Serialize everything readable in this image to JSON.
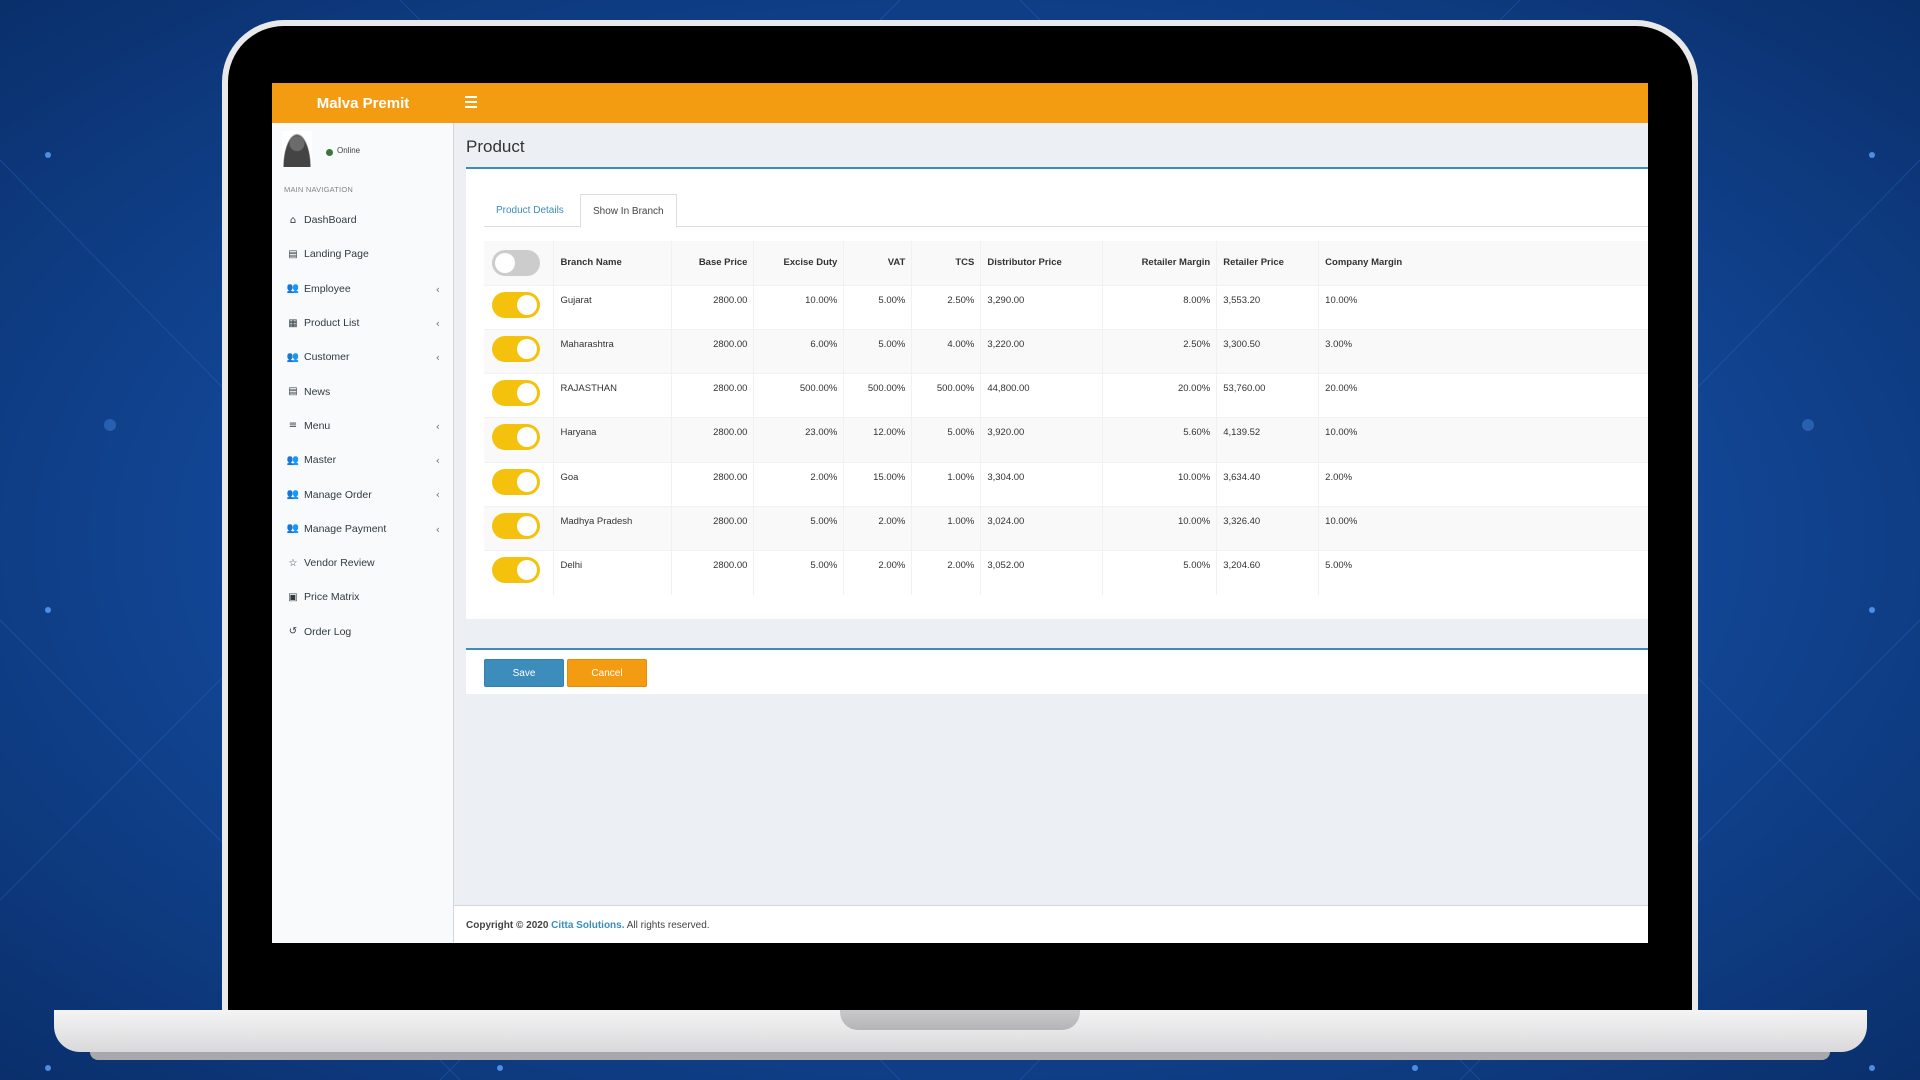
{
  "app": {
    "brand": "Malva Premit",
    "page_title": "Product"
  },
  "user": {
    "status": "Online"
  },
  "sidebar": {
    "header": "MAIN NAVIGATION",
    "items": [
      {
        "label": "DashBoard",
        "icon": "home-icon",
        "glyph": "⌂",
        "has_children": false
      },
      {
        "label": "Landing Page",
        "icon": "id-card-icon",
        "glyph": "▤",
        "has_children": false
      },
      {
        "label": "Employee",
        "icon": "users-icon",
        "glyph": "👥",
        "has_children": true
      },
      {
        "label": "Product List",
        "icon": "list-icon",
        "glyph": "▦",
        "has_children": true
      },
      {
        "label": "Customer",
        "icon": "users-icon",
        "glyph": "👥",
        "has_children": true
      },
      {
        "label": "News",
        "icon": "newspaper-icon",
        "glyph": "▤",
        "has_children": false
      },
      {
        "label": "Menu",
        "icon": "bars-icon",
        "glyph": "≡",
        "has_children": true
      },
      {
        "label": "Master",
        "icon": "users-icon",
        "glyph": "👥",
        "has_children": true
      },
      {
        "label": "Manage Order",
        "icon": "users-icon",
        "glyph": "👥",
        "has_children": true
      },
      {
        "label": "Manage Payment",
        "icon": "users-icon",
        "glyph": "👥",
        "has_children": true
      },
      {
        "label": "Vendor Review",
        "icon": "star-icon",
        "glyph": "☆",
        "has_children": false
      },
      {
        "label": "Price Matrix",
        "icon": "money-icon",
        "glyph": "▣",
        "has_children": false
      },
      {
        "label": "Order Log",
        "icon": "history-icon",
        "glyph": "↺",
        "has_children": false
      }
    ]
  },
  "tabs": [
    {
      "label": "Product Details",
      "active": false
    },
    {
      "label": "Show In Branch",
      "active": true
    }
  ],
  "table": {
    "header_toggle_on": false,
    "columns": [
      "Branch Name",
      "Base Price",
      "Excise Duty",
      "VAT",
      "TCS",
      "Distributor Price",
      "Retailer Margin",
      "Retailer Price",
      "Company Margin"
    ],
    "rows": [
      {
        "enabled": true,
        "branch": "Gujarat",
        "base_price": "2800.00",
        "excise": "10.00%",
        "vat": "5.00%",
        "tcs": "2.50%",
        "distributor_price": "3,290.00",
        "retailer_margin": "8.00%",
        "retailer_price": "3,553.20",
        "company_margin": "10.00%"
      },
      {
        "enabled": true,
        "branch": "Maharashtra",
        "base_price": "2800.00",
        "excise": "6.00%",
        "vat": "5.00%",
        "tcs": "4.00%",
        "distributor_price": "3,220.00",
        "retailer_margin": "2.50%",
        "retailer_price": "3,300.50",
        "company_margin": "3.00%"
      },
      {
        "enabled": true,
        "branch": "RAJASTHAN",
        "base_price": "2800.00",
        "excise": "500.00%",
        "vat": "500.00%",
        "tcs": "500.00%",
        "distributor_price": "44,800.00",
        "retailer_margin": "20.00%",
        "retailer_price": "53,760.00",
        "company_margin": "20.00%"
      },
      {
        "enabled": true,
        "branch": "Haryana",
        "base_price": "2800.00",
        "excise": "23.00%",
        "vat": "12.00%",
        "tcs": "5.00%",
        "distributor_price": "3,920.00",
        "retailer_margin": "5.60%",
        "retailer_price": "4,139.52",
        "company_margin": "10.00%"
      },
      {
        "enabled": true,
        "branch": "Goa",
        "base_price": "2800.00",
        "excise": "2.00%",
        "vat": "15.00%",
        "tcs": "1.00%",
        "distributor_price": "3,304.00",
        "retailer_margin": "10.00%",
        "retailer_price": "3,634.40",
        "company_margin": "2.00%"
      },
      {
        "enabled": true,
        "branch": "Madhya Pradesh",
        "base_price": "2800.00",
        "excise": "5.00%",
        "vat": "2.00%",
        "tcs": "1.00%",
        "distributor_price": "3,024.00",
        "retailer_margin": "10.00%",
        "retailer_price": "3,326.40",
        "company_margin": "10.00%"
      },
      {
        "enabled": true,
        "branch": "Delhi",
        "base_price": "2800.00",
        "excise": "5.00%",
        "vat": "2.00%",
        "tcs": "2.00%",
        "distributor_price": "3,052.00",
        "retailer_margin": "5.00%",
        "retailer_price": "3,204.60",
        "company_margin": "5.00%"
      }
    ]
  },
  "actions": {
    "save": "Save",
    "cancel": "Cancel"
  },
  "footer": {
    "prefix": "Copyright © 2020",
    "company": "Citta Solutions.",
    "suffix": "All rights reserved."
  },
  "colors": {
    "topbar": "#f39c12",
    "accent": "#3c8dbc",
    "toggle_on": "#f4c20d",
    "toggle_off": "#cccccc"
  }
}
